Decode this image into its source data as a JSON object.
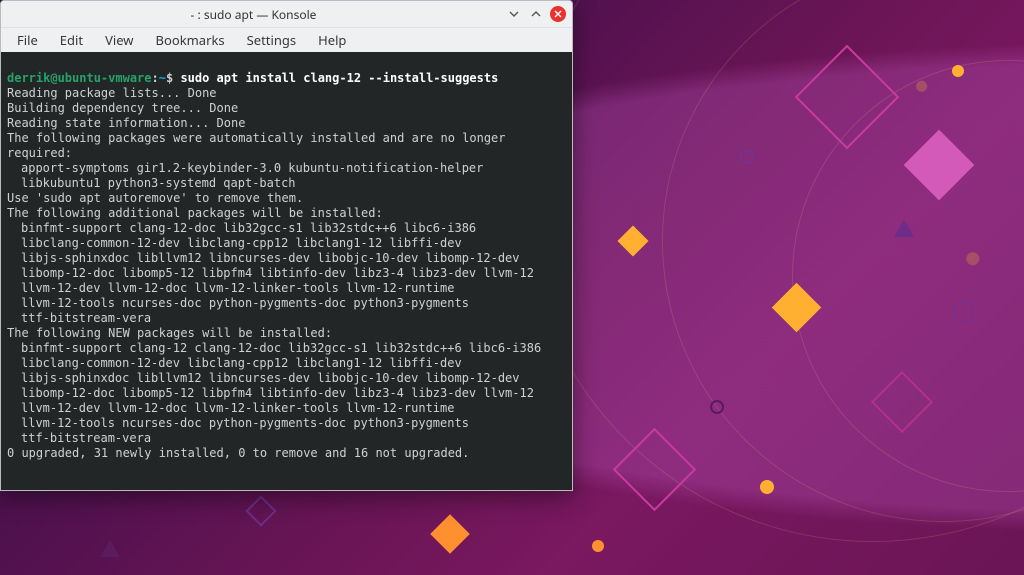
{
  "window": {
    "title": "- : sudo apt — Konsole"
  },
  "menu": {
    "file": "File",
    "edit": "Edit",
    "view": "View",
    "bookmarks": "Bookmarks",
    "settings": "Settings",
    "help": "Help"
  },
  "prompt": {
    "user_host": "derrik@ubuntu-vmware",
    "separator": ":",
    "path": "~",
    "symbol": "$"
  },
  "command": "sudo apt install clang-12 --install-suggests",
  "output": {
    "reading_lists": "Reading package lists... Done",
    "building_tree": "Building dependency tree... Done",
    "reading_state": "Reading state information... Done",
    "auto_header": "The following packages were automatically installed and are no longer required:",
    "auto_pkgs_l1": "apport-symptoms gir1.2-keybinder-3.0 kubuntu-notification-helper",
    "auto_pkgs_l2": "libkubuntu1 python3-systemd qapt-batch",
    "autoremove_hint": "Use 'sudo apt autoremove' to remove them.",
    "additional_header": "The following additional packages will be installed:",
    "additional_l1": "binfmt-support clang-12-doc lib32gcc-s1 lib32stdc++6 libc6-i386",
    "additional_l2": "libclang-common-12-dev libclang-cpp12 libclang1-12 libffi-dev",
    "additional_l3": "libjs-sphinxdoc libllvm12 libncurses-dev libobjc-10-dev libomp-12-dev",
    "additional_l4": "libomp-12-doc libomp5-12 libpfm4 libtinfo-dev libz3-4 libz3-dev llvm-12",
    "additional_l5": "llvm-12-dev llvm-12-doc llvm-12-linker-tools llvm-12-runtime",
    "additional_l6": "llvm-12-tools ncurses-doc python-pygments-doc python3-pygments",
    "additional_l7": "ttf-bitstream-vera",
    "new_header": "The following NEW packages will be installed:",
    "new_l1": "binfmt-support clang-12 clang-12-doc lib32gcc-s1 lib32stdc++6 libc6-i386",
    "new_l2": "libclang-common-12-dev libclang-cpp12 libclang1-12 libffi-dev",
    "new_l3": "libjs-sphinxdoc libllvm12 libncurses-dev libobjc-10-dev libomp-12-dev",
    "new_l4": "libomp-12-doc libomp5-12 libpfm4 libtinfo-dev libz3-4 libz3-dev llvm-12",
    "new_l5": "llvm-12-dev llvm-12-doc llvm-12-linker-tools llvm-12-runtime",
    "new_l6": "llvm-12-tools ncurses-doc python-pygments-doc python3-pygments",
    "new_l7": "ttf-bitstream-vera",
    "summary": "0 upgraded, 31 newly installed, 0 to remove and 16 not upgraded."
  }
}
